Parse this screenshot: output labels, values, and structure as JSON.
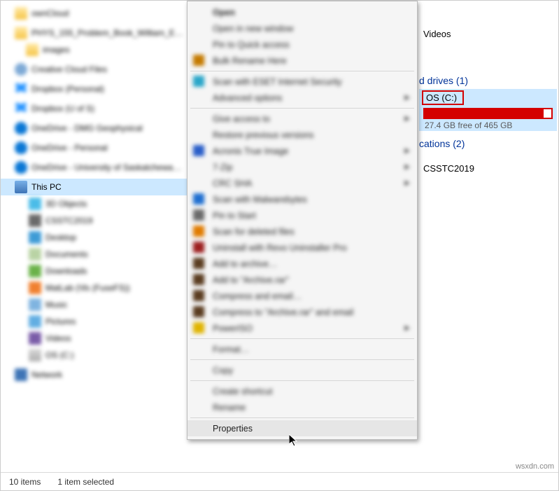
{
  "tree": {
    "ownCloud": "ownCloud",
    "phys": "PHYS_155_Problem_Book_William_E…",
    "images": "images",
    "ccf": "Creative Cloud Files",
    "dbp": "Dropbox (Personal)",
    "dbu": "Dropbox (U of S)",
    "od1": "OneDrive - DMG Geophysical",
    "od2": "OneDrive - Personal",
    "od3": "OneDrive - University of Saskatchewa…",
    "thispc": "This PC",
    "obj3d": "3D Objects",
    "csstc": "CSSTC2019",
    "desktop": "Desktop",
    "documents": "Documents",
    "downloads": "Downloads",
    "matlab": "MatLab  (\\\\fs (FuseFS))",
    "music": "Music",
    "pictures": "Pictures",
    "videos": "Videos",
    "osc": "OS (C:)",
    "network": "Network"
  },
  "main": {
    "videos": "Videos",
    "drives_head": "d drives (1)",
    "drive_name": "OS (C:)",
    "drive_sub": "27.4 GB free of 465 GB",
    "locations_head": "cations (2)",
    "location1": "CSSTC2019"
  },
  "ctx": {
    "open": "Open",
    "open_new": "Open in new window",
    "pin_quick": "Pin to Quick access",
    "bulk": "Bulk Rename Here",
    "eset": "Scan with ESET Internet Security",
    "adv": "Advanced options",
    "give": "Give access to",
    "restore": "Restore previous versions",
    "acronis": "Acronis True Image",
    "sevenzip": "7-Zip",
    "crc": "CRC SHA",
    "mbam": "Scan with Malwarebytes",
    "pin_start": "Pin to Start",
    "scan_del": "Scan for deleted files",
    "revo": "Uninstall with Revo Uninstaller Pro",
    "add_arch": "Add to archive…",
    "add_rar": "Add to \"Archive.rar\"",
    "comp_email": "Compress and email…",
    "comp_rar_email": "Compress to \"Archive.rar\" and email",
    "poweriso": "PowerISO",
    "format": "Format…",
    "copy": "Copy",
    "shortcut": "Create shortcut",
    "rename": "Rename",
    "properties": "Properties"
  },
  "status": {
    "count": "10 items",
    "sel": "1 item selected"
  },
  "watermark": "wsxdn.com"
}
